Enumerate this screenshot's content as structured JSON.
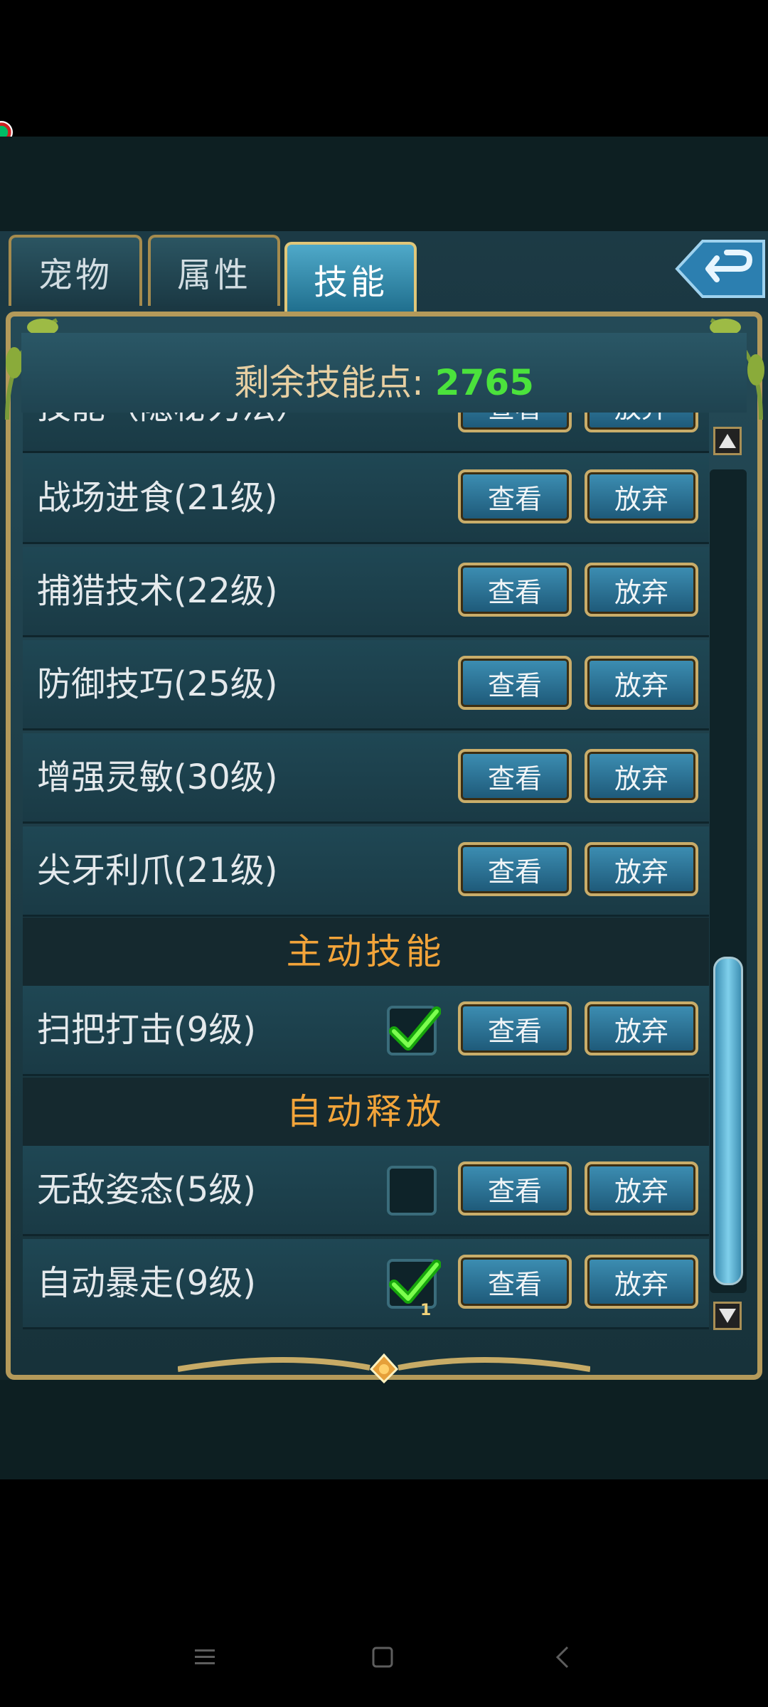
{
  "tabs": [
    {
      "label": "宠物",
      "active": false
    },
    {
      "label": "属性",
      "active": false
    },
    {
      "label": "技能",
      "active": true
    }
  ],
  "header": {
    "points_label": "剩余技能点:",
    "points_value": "2765"
  },
  "buttons": {
    "view": "查看",
    "drop": "放弃"
  },
  "partial_row": {
    "name": "技能（隐秘力法）"
  },
  "passive_skills": [
    {
      "name": "战场进食(21级)"
    },
    {
      "name": "捕猎技术(22级)"
    },
    {
      "name": "防御技巧(25级)"
    },
    {
      "name": "增强灵敏(30级)"
    },
    {
      "name": "尖牙利爪(21级)"
    }
  ],
  "sections": {
    "active": "主动技能",
    "auto": "自动释放"
  },
  "active_skills": [
    {
      "name": "扫把打击(9级)",
      "checked": true
    }
  ],
  "auto_skills": [
    {
      "name": "无敌姿态(5级)",
      "checked": false
    },
    {
      "name": "自动暴走(9级)",
      "checked": true,
      "count": "1"
    }
  ],
  "scroll_position": 0.85,
  "colors": {
    "accent_gold": "#b49a5a",
    "points_green": "#4be23c",
    "section_orange": "#f2a43a"
  },
  "icons": {
    "back": "back-arrow-icon",
    "scroll_up": "triangle-up-icon",
    "scroll_down": "triangle-down-icon",
    "check": "check-icon"
  }
}
